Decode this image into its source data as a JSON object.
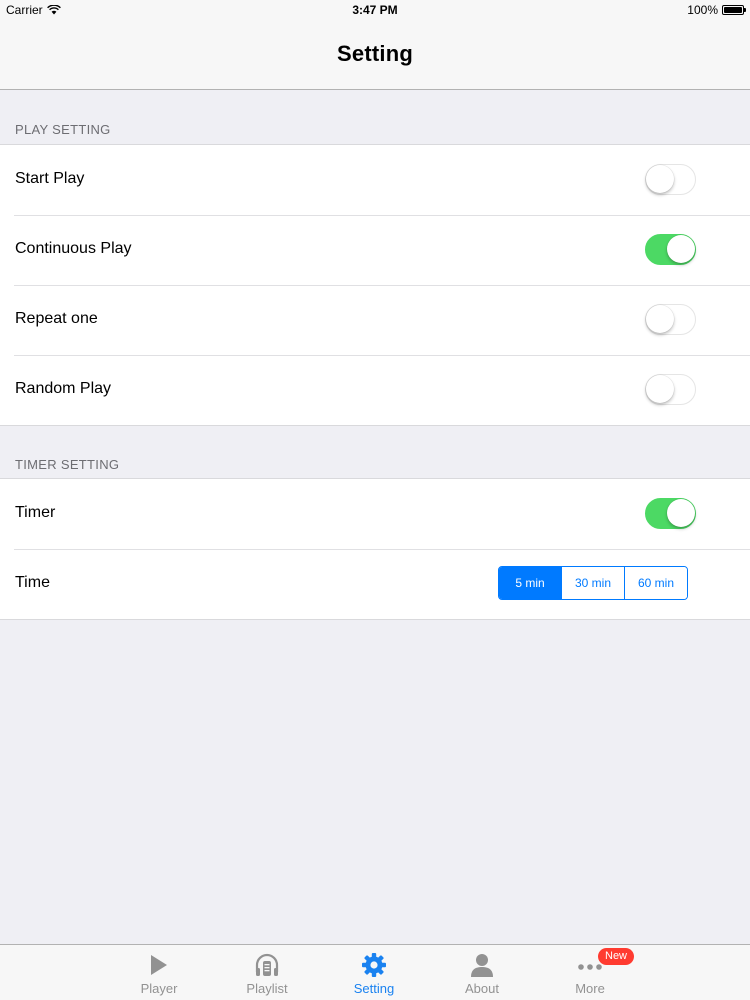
{
  "status_bar": {
    "carrier": "Carrier",
    "time": "3:47 PM",
    "battery": "100%"
  },
  "nav": {
    "title": "Setting"
  },
  "sections": {
    "play": {
      "header": "PLAY SETTING",
      "rows": [
        {
          "label": "Start Play",
          "on": false
        },
        {
          "label": "Continuous Play",
          "on": true
        },
        {
          "label": "Repeat one",
          "on": false
        },
        {
          "label": "Random Play",
          "on": false
        }
      ]
    },
    "timer": {
      "header": "TIMER SETTING",
      "timer_label": "Timer",
      "timer_on": true,
      "time_label": "Time",
      "time_options": [
        "5 min",
        "30 min",
        "60 min"
      ],
      "time_selected": "5 min"
    }
  },
  "tab_bar": {
    "tabs": [
      {
        "label": "Player",
        "icon": "play-icon"
      },
      {
        "label": "Playlist",
        "icon": "playlist-icon"
      },
      {
        "label": "Setting",
        "icon": "gear-icon",
        "active": true
      },
      {
        "label": "About",
        "icon": "person-icon"
      },
      {
        "label": "More",
        "icon": "more-icon",
        "badge": "New"
      }
    ]
  },
  "colors": {
    "accent": "#007aff",
    "switch_on": "#4cd964",
    "badge": "#ff3b30"
  }
}
